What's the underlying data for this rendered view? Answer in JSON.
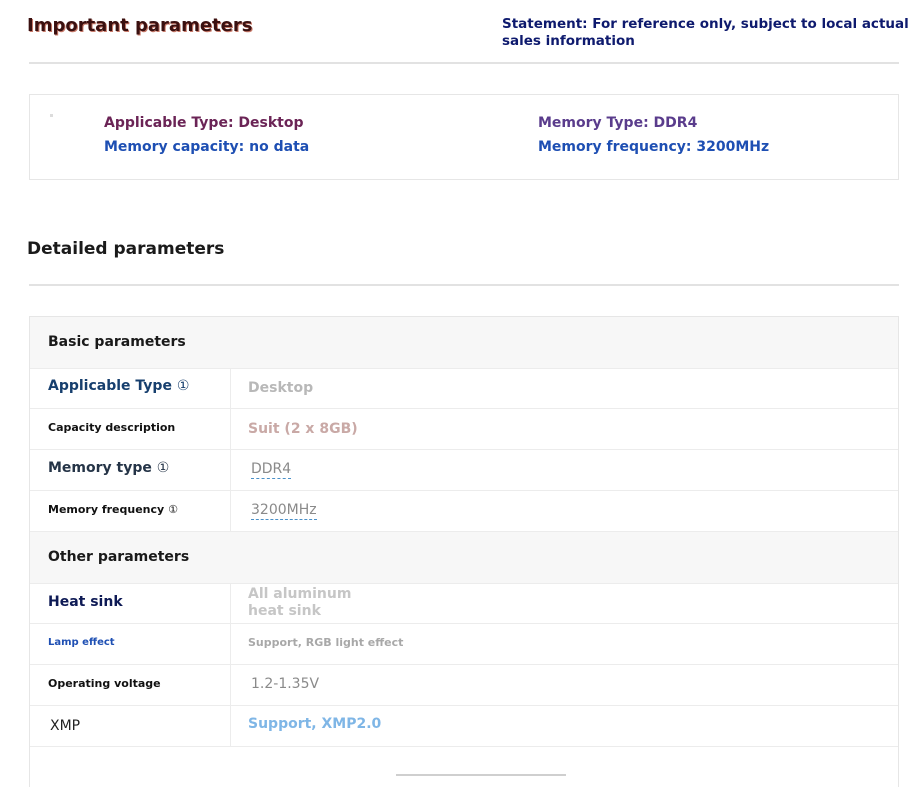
{
  "important": {
    "title": "Important parameters",
    "statement": "Statement: For reference only, subject to local actual sales information",
    "applicable_type": "Applicable Type: Desktop",
    "memory_capacity": "Memory capacity: no data",
    "memory_type": "Memory Type: DDR4",
    "memory_frequency": "Memory frequency: 3200MHz"
  },
  "detailed": {
    "title": "Detailed parameters",
    "sections": [
      {
        "heading": "Basic parameters",
        "rows": [
          {
            "label": "Applicable Type",
            "info": "①",
            "value": "Desktop"
          },
          {
            "label": "Capacity description",
            "info": "",
            "value": "Suit (2 x 8GB)"
          },
          {
            "label": "Memory type",
            "info": "①",
            "value": "DDR4"
          },
          {
            "label": "Memory frequency",
            "info": "①",
            "value": "3200MHz"
          }
        ]
      },
      {
        "heading": "Other parameters",
        "rows": [
          {
            "label": "Heat sink",
            "info": "",
            "value": "All aluminum heat sink"
          },
          {
            "label": "Lamp effect",
            "info": "",
            "value": "Support, RGB light effect"
          },
          {
            "label": "Operating voltage",
            "info": "",
            "value": "1.2-1.35V"
          },
          {
            "label": "XMP",
            "info": "",
            "value": "Support, XMP2.0"
          }
        ]
      }
    ]
  },
  "colors": {
    "accent_blue": "#1e4fb3",
    "purple": "#6b2456",
    "link_light_blue": "#7fb6e6"
  }
}
